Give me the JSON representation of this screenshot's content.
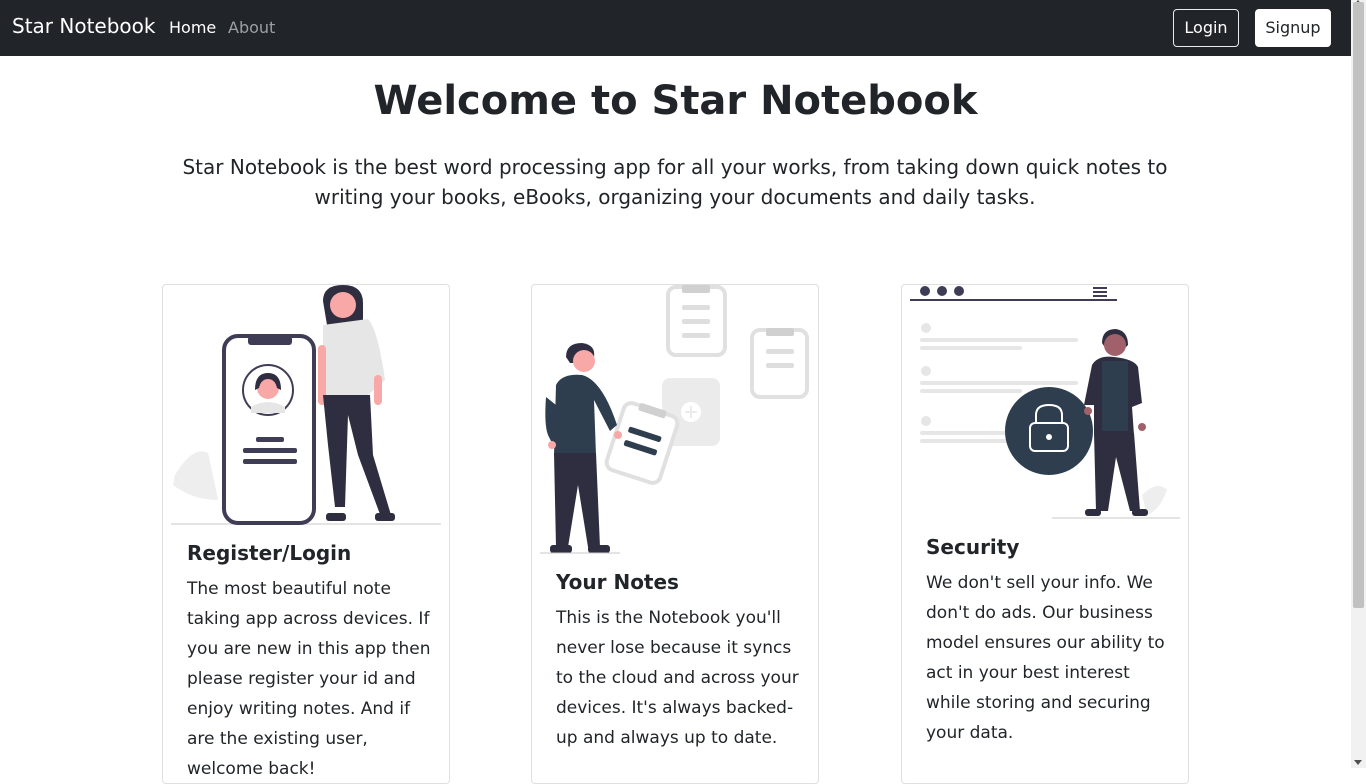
{
  "navbar": {
    "brand": "Star Notebook",
    "links": [
      {
        "label": "Home",
        "active": true
      },
      {
        "label": "About",
        "active": false
      }
    ],
    "login_label": "Login",
    "signup_label": "Signup"
  },
  "hero": {
    "title": "Welcome to Star Notebook",
    "description": "Star Notebook is the best word processing app for all your works, from taking down quick notes to writing your books, eBooks, organizing your documents and daily tasks."
  },
  "cards": [
    {
      "illustration": "register-illustration",
      "title": "Register/Login",
      "text": "The most beautiful note taking app across devices. If you are new in this app then please register your id and enjoy writing notes. And if are the existing user, welcome back!"
    },
    {
      "illustration": "notes-illustration",
      "title": "Your Notes",
      "text": "This is the Notebook you'll never lose because it syncs to the cloud and across your devices. It's always backed-up and always up to date."
    },
    {
      "illustration": "security-illustration",
      "title": "Security",
      "text": "We don't sell your info. We don't do ads. Our business model ensures our ability to act in your best interest while storing and securing your data."
    }
  ],
  "colors": {
    "navbar_bg": "#212529",
    "accent_pink": "#f9a8a8",
    "dark_figure": "#2f2e41",
    "lock_circle": "#2f3e4e"
  }
}
